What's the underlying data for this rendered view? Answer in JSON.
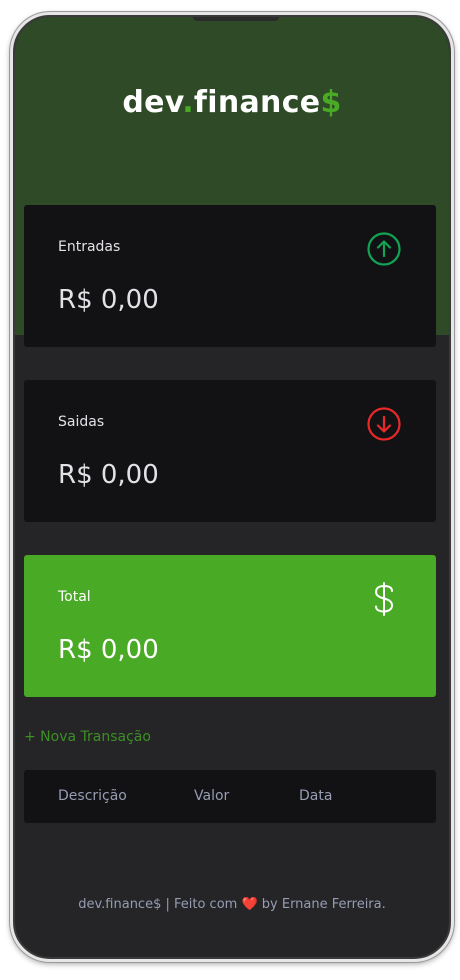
{
  "app": {
    "logo_main": "dev",
    "logo_dot": ".",
    "logo_name": "finance",
    "logo_dollar": "$"
  },
  "cards": {
    "income": {
      "label": "Entradas",
      "value": "R$ 0,00",
      "icon": "arrow-up-circle-icon"
    },
    "expense": {
      "label": "Saidas",
      "value": "R$ 0,00",
      "icon": "arrow-down-circle-icon"
    },
    "total": {
      "label": "Total",
      "value": "R$ 0,00",
      "icon": "dollar-sign-icon"
    }
  },
  "actions": {
    "new_transaction": "+ Nova Transação"
  },
  "table": {
    "columns": [
      "Descrição",
      "Valor",
      "Data"
    ]
  },
  "footer": {
    "before": "dev.finance$ | Feito com ",
    "heart": "❤️",
    "after": " by Ernane Ferreira."
  },
  "colors": {
    "brand_green": "#49aa26",
    "income_green": "#12a454",
    "expense_red": "#e92929",
    "card_bg": "#121214",
    "header_bg": "#2f4a26"
  }
}
